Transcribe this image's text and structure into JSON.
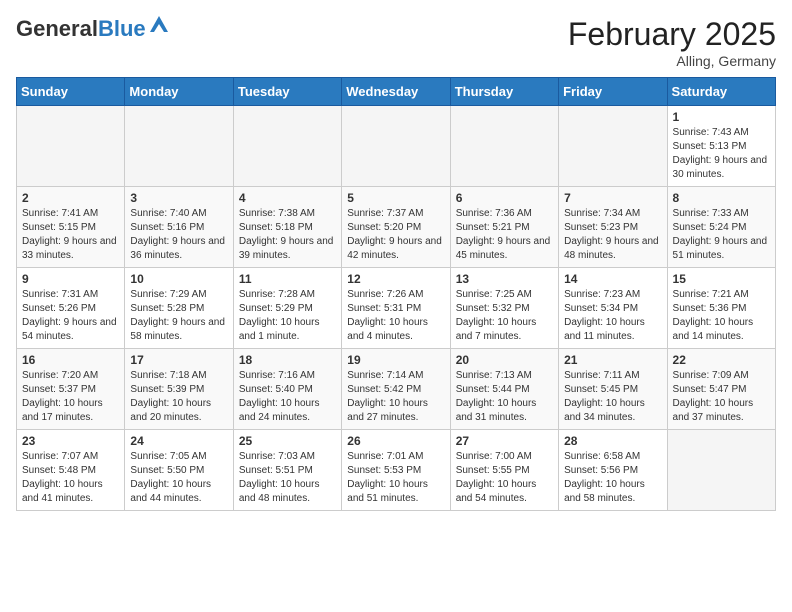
{
  "header": {
    "logo_general": "General",
    "logo_blue": "Blue",
    "month_title": "February 2025",
    "location": "Alling, Germany"
  },
  "days_of_week": [
    "Sunday",
    "Monday",
    "Tuesday",
    "Wednesday",
    "Thursday",
    "Friday",
    "Saturday"
  ],
  "weeks": [
    [
      {
        "day": "",
        "info": ""
      },
      {
        "day": "",
        "info": ""
      },
      {
        "day": "",
        "info": ""
      },
      {
        "day": "",
        "info": ""
      },
      {
        "day": "",
        "info": ""
      },
      {
        "day": "",
        "info": ""
      },
      {
        "day": "1",
        "info": "Sunrise: 7:43 AM\nSunset: 5:13 PM\nDaylight: 9 hours and 30 minutes."
      }
    ],
    [
      {
        "day": "2",
        "info": "Sunrise: 7:41 AM\nSunset: 5:15 PM\nDaylight: 9 hours and 33 minutes."
      },
      {
        "day": "3",
        "info": "Sunrise: 7:40 AM\nSunset: 5:16 PM\nDaylight: 9 hours and 36 minutes."
      },
      {
        "day": "4",
        "info": "Sunrise: 7:38 AM\nSunset: 5:18 PM\nDaylight: 9 hours and 39 minutes."
      },
      {
        "day": "5",
        "info": "Sunrise: 7:37 AM\nSunset: 5:20 PM\nDaylight: 9 hours and 42 minutes."
      },
      {
        "day": "6",
        "info": "Sunrise: 7:36 AM\nSunset: 5:21 PM\nDaylight: 9 hours and 45 minutes."
      },
      {
        "day": "7",
        "info": "Sunrise: 7:34 AM\nSunset: 5:23 PM\nDaylight: 9 hours and 48 minutes."
      },
      {
        "day": "8",
        "info": "Sunrise: 7:33 AM\nSunset: 5:24 PM\nDaylight: 9 hours and 51 minutes."
      }
    ],
    [
      {
        "day": "9",
        "info": "Sunrise: 7:31 AM\nSunset: 5:26 PM\nDaylight: 9 hours and 54 minutes."
      },
      {
        "day": "10",
        "info": "Sunrise: 7:29 AM\nSunset: 5:28 PM\nDaylight: 9 hours and 58 minutes."
      },
      {
        "day": "11",
        "info": "Sunrise: 7:28 AM\nSunset: 5:29 PM\nDaylight: 10 hours and 1 minute."
      },
      {
        "day": "12",
        "info": "Sunrise: 7:26 AM\nSunset: 5:31 PM\nDaylight: 10 hours and 4 minutes."
      },
      {
        "day": "13",
        "info": "Sunrise: 7:25 AM\nSunset: 5:32 PM\nDaylight: 10 hours and 7 minutes."
      },
      {
        "day": "14",
        "info": "Sunrise: 7:23 AM\nSunset: 5:34 PM\nDaylight: 10 hours and 11 minutes."
      },
      {
        "day": "15",
        "info": "Sunrise: 7:21 AM\nSunset: 5:36 PM\nDaylight: 10 hours and 14 minutes."
      }
    ],
    [
      {
        "day": "16",
        "info": "Sunrise: 7:20 AM\nSunset: 5:37 PM\nDaylight: 10 hours and 17 minutes."
      },
      {
        "day": "17",
        "info": "Sunrise: 7:18 AM\nSunset: 5:39 PM\nDaylight: 10 hours and 20 minutes."
      },
      {
        "day": "18",
        "info": "Sunrise: 7:16 AM\nSunset: 5:40 PM\nDaylight: 10 hours and 24 minutes."
      },
      {
        "day": "19",
        "info": "Sunrise: 7:14 AM\nSunset: 5:42 PM\nDaylight: 10 hours and 27 minutes."
      },
      {
        "day": "20",
        "info": "Sunrise: 7:13 AM\nSunset: 5:44 PM\nDaylight: 10 hours and 31 minutes."
      },
      {
        "day": "21",
        "info": "Sunrise: 7:11 AM\nSunset: 5:45 PM\nDaylight: 10 hours and 34 minutes."
      },
      {
        "day": "22",
        "info": "Sunrise: 7:09 AM\nSunset: 5:47 PM\nDaylight: 10 hours and 37 minutes."
      }
    ],
    [
      {
        "day": "23",
        "info": "Sunrise: 7:07 AM\nSunset: 5:48 PM\nDaylight: 10 hours and 41 minutes."
      },
      {
        "day": "24",
        "info": "Sunrise: 7:05 AM\nSunset: 5:50 PM\nDaylight: 10 hours and 44 minutes."
      },
      {
        "day": "25",
        "info": "Sunrise: 7:03 AM\nSunset: 5:51 PM\nDaylight: 10 hours and 48 minutes."
      },
      {
        "day": "26",
        "info": "Sunrise: 7:01 AM\nSunset: 5:53 PM\nDaylight: 10 hours and 51 minutes."
      },
      {
        "day": "27",
        "info": "Sunrise: 7:00 AM\nSunset: 5:55 PM\nDaylight: 10 hours and 54 minutes."
      },
      {
        "day": "28",
        "info": "Sunrise: 6:58 AM\nSunset: 5:56 PM\nDaylight: 10 hours and 58 minutes."
      },
      {
        "day": "",
        "info": ""
      }
    ]
  ]
}
